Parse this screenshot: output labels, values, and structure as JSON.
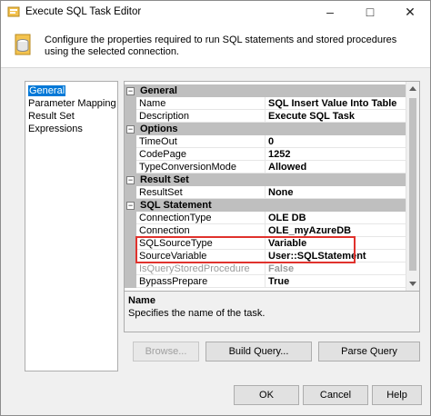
{
  "window": {
    "title": "Execute SQL Task Editor"
  },
  "header": {
    "description": "Configure the properties required to run SQL statements and stored procedures using the selected connection."
  },
  "nav": {
    "items": [
      "General",
      "Parameter Mapping",
      "Result Set",
      "Expressions"
    ],
    "selected": "General"
  },
  "grid": {
    "categories": [
      {
        "label": "General",
        "toggle": "−",
        "rows": [
          {
            "name": "Name",
            "value": "SQL Insert Value Into Table"
          },
          {
            "name": "Description",
            "value": "Execute SQL Task"
          }
        ]
      },
      {
        "label": "Options",
        "toggle": "−",
        "rows": [
          {
            "name": "TimeOut",
            "value": "0"
          },
          {
            "name": "CodePage",
            "value": "1252"
          },
          {
            "name": "TypeConversionMode",
            "value": "Allowed"
          }
        ]
      },
      {
        "label": "Result Set",
        "toggle": "−",
        "rows": [
          {
            "name": "ResultSet",
            "value": "None"
          }
        ]
      },
      {
        "label": "SQL Statement",
        "toggle": "−",
        "rows": [
          {
            "name": "ConnectionType",
            "value": "OLE DB"
          },
          {
            "name": "Connection",
            "value": "OLE_myAzureDB"
          },
          {
            "name": "SQLSourceType",
            "value": "Variable"
          },
          {
            "name": "SourceVariable",
            "value": "User::SQLStatement"
          },
          {
            "name": "IsQueryStoredProcedure",
            "value": "False"
          },
          {
            "name": "BypassPrepare",
            "value": "True"
          }
        ]
      }
    ]
  },
  "description_panel": {
    "title": "Name",
    "text": "Specifies the name of the task."
  },
  "buttons": {
    "browse": "Browse...",
    "build_query": "Build Query...",
    "parse_query": "Parse Query",
    "ok": "OK",
    "cancel": "Cancel",
    "help": "Help"
  },
  "colors": {
    "highlight": "#e0322d",
    "selection": "#0078d7",
    "category": "#bfbfbf"
  }
}
